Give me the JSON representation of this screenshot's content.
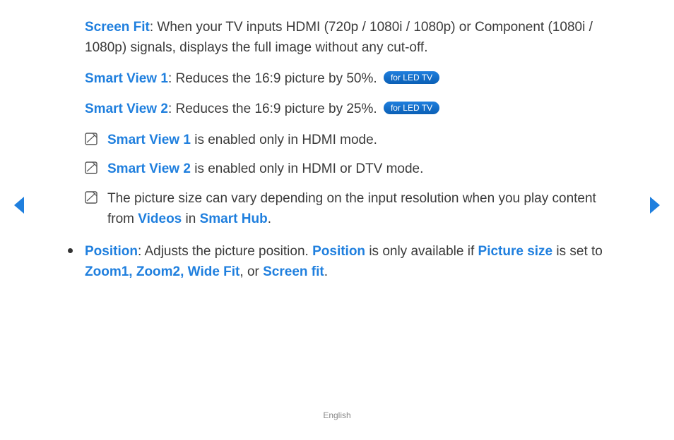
{
  "items": {
    "screenFit": {
      "term": "Screen Fit",
      "desc": ": When your TV inputs HDMI (720p / 1080i / 1080p) or Component (1080i / 1080p) signals, displays the full image without any cut-off."
    },
    "smartView1": {
      "term": "Smart View 1",
      "desc": ": Reduces the 16:9 picture by 50%. ",
      "badge": "for LED TV"
    },
    "smartView2": {
      "term": "Smart View 2",
      "desc": ": Reduces the 16:9 picture by 25%. ",
      "badge": "for LED TV"
    }
  },
  "notes": [
    {
      "term": "Smart View 1",
      "rest": " is enabled only in HDMI mode."
    },
    {
      "term": "Smart View 2",
      "rest": " is enabled only in HDMI or DTV mode."
    }
  ],
  "note3": {
    "pre": "The picture size can vary depending on the input resolution when you play content from ",
    "link1": "Videos",
    "mid": " in ",
    "link2": "Smart Hub",
    "post": "."
  },
  "position": {
    "term": "Position",
    "part1": ": Adjusts the picture position. ",
    "term2": "Position",
    "part2": " is only available if ",
    "term3": "Picture size",
    "part3": " is set to ",
    "term4": "Zoom1, Zoom2, Wide Fit",
    "part4": ", or ",
    "term5": "Screen fit",
    "part5": "."
  },
  "footer": "English",
  "icons": {
    "note": "note-icon",
    "prev": "triangle-left-icon",
    "next": "triangle-right-icon"
  }
}
